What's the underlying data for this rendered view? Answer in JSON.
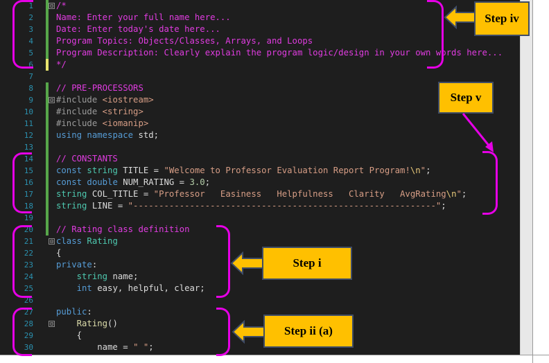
{
  "editor": {
    "lines": [
      {
        "n": "1",
        "fold": "⊟",
        "parts": [
          {
            "t": "/*",
            "c": "c-pink"
          }
        ]
      },
      {
        "n": "2",
        "parts": [
          {
            "t": "Name: Enter your full name here...",
            "c": "c-pink"
          }
        ]
      },
      {
        "n": "3",
        "parts": [
          {
            "t": "Date: Enter today's date here...",
            "c": "c-pink"
          }
        ]
      },
      {
        "n": "4",
        "parts": [
          {
            "t": "Program Topics: Objects/Classes, Arrays, and Loops",
            "c": "c-pink"
          }
        ]
      },
      {
        "n": "5",
        "parts": [
          {
            "t": "Program Description: Clearly explain the program logic/design in your own words here...",
            "c": "c-pink"
          }
        ]
      },
      {
        "n": "6",
        "parts": [
          {
            "t": "*/",
            "c": "c-pink"
          }
        ]
      },
      {
        "n": "7",
        "parts": []
      },
      {
        "n": "8",
        "parts": [
          {
            "t": "// PRE-PROCESSORS",
            "c": "c-pink"
          }
        ]
      },
      {
        "n": "9",
        "fold": "⊟",
        "parts": [
          {
            "t": "#include ",
            "c": "c-pp"
          },
          {
            "t": "<iostream>",
            "c": "c-str"
          }
        ]
      },
      {
        "n": "10",
        "parts": [
          {
            "t": "#include ",
            "c": "c-pp"
          },
          {
            "t": "<string>",
            "c": "c-str"
          }
        ]
      },
      {
        "n": "11",
        "parts": [
          {
            "t": "#include ",
            "c": "c-pp"
          },
          {
            "t": "<iomanip>",
            "c": "c-str"
          }
        ]
      },
      {
        "n": "12",
        "parts": [
          {
            "t": "using ",
            "c": "c-kw"
          },
          {
            "t": "namespace ",
            "c": "c-kw"
          },
          {
            "t": "std;",
            "c": ""
          }
        ]
      },
      {
        "n": "13",
        "parts": []
      },
      {
        "n": "14",
        "parts": [
          {
            "t": "// CONSTANTS",
            "c": "c-pink"
          }
        ]
      },
      {
        "n": "15",
        "parts": [
          {
            "t": "const ",
            "c": "c-kw"
          },
          {
            "t": "string ",
            "c": "c-type"
          },
          {
            "t": "TITLE = ",
            "c": ""
          },
          {
            "t": "\"Welcome to Professor Evaluation Report Program!",
            "c": "c-str"
          },
          {
            "t": "\\n",
            "c": "c-esc"
          },
          {
            "t": "\"",
            "c": "c-str"
          },
          {
            "t": ";",
            "c": ""
          }
        ]
      },
      {
        "n": "16",
        "parts": [
          {
            "t": "const ",
            "c": "c-kw"
          },
          {
            "t": "double ",
            "c": "c-kw"
          },
          {
            "t": "NUM_RATING = ",
            "c": ""
          },
          {
            "t": "3.0",
            "c": "c-num"
          },
          {
            "t": ";",
            "c": ""
          }
        ]
      },
      {
        "n": "17",
        "parts": [
          {
            "t": "string ",
            "c": "c-type"
          },
          {
            "t": "COL_TITLE = ",
            "c": ""
          },
          {
            "t": "\"Professor   Easiness   Helpfulness   Clarity   AvgRating",
            "c": "c-str"
          },
          {
            "t": "\\n",
            "c": "c-esc"
          },
          {
            "t": "\"",
            "c": "c-str"
          },
          {
            "t": ";",
            "c": ""
          }
        ]
      },
      {
        "n": "18",
        "parts": [
          {
            "t": "string ",
            "c": "c-type"
          },
          {
            "t": "LINE = ",
            "c": ""
          },
          {
            "t": "\"-----------------------------------------------------------\"",
            "c": "c-str"
          },
          {
            "t": ";",
            "c": ""
          }
        ]
      },
      {
        "n": "19",
        "parts": []
      },
      {
        "n": "20",
        "parts": [
          {
            "t": "// Rating class definition",
            "c": "c-pink"
          }
        ]
      },
      {
        "n": "21",
        "fold": "⊟",
        "parts": [
          {
            "t": "class ",
            "c": "c-kw"
          },
          {
            "t": "Rating",
            "c": "c-type"
          }
        ]
      },
      {
        "n": "22",
        "parts": [
          {
            "t": "{",
            "c": ""
          }
        ]
      },
      {
        "n": "23",
        "parts": [
          {
            "t": "private",
            "c": "c-kw"
          },
          {
            "t": ":",
            "c": ""
          }
        ]
      },
      {
        "n": "24",
        "parts": [
          {
            "t": "    string ",
            "c": "c-type"
          },
          {
            "t": "name;",
            "c": ""
          }
        ]
      },
      {
        "n": "25",
        "parts": [
          {
            "t": "    int ",
            "c": "c-kw"
          },
          {
            "t": "easy, helpful, clear;",
            "c": ""
          }
        ]
      },
      {
        "n": "26",
        "parts": []
      },
      {
        "n": "27",
        "parts": [
          {
            "t": "public",
            "c": "c-kw"
          },
          {
            "t": ":",
            "c": ""
          }
        ]
      },
      {
        "n": "28",
        "fold": "⊟",
        "parts": [
          {
            "t": "    Rating",
            "c": "c-fn"
          },
          {
            "t": "()",
            "c": ""
          }
        ]
      },
      {
        "n": "29",
        "parts": [
          {
            "t": "    {",
            "c": ""
          }
        ]
      },
      {
        "n": "30",
        "parts": [
          {
            "t": "        name = ",
            "c": ""
          },
          {
            "t": "\" \"",
            "c": "c-str"
          },
          {
            "t": ";",
            "c": ""
          }
        ]
      }
    ]
  },
  "callouts": {
    "step_iv": "Step iv",
    "step_v": "Step v",
    "step_i": "Step i",
    "step_ii_a": "Step ii (a)"
  },
  "colors": {
    "accent_bracket": "#e600e6",
    "callout_fill": "#ffc000",
    "callout_border": "#3f4c66"
  }
}
